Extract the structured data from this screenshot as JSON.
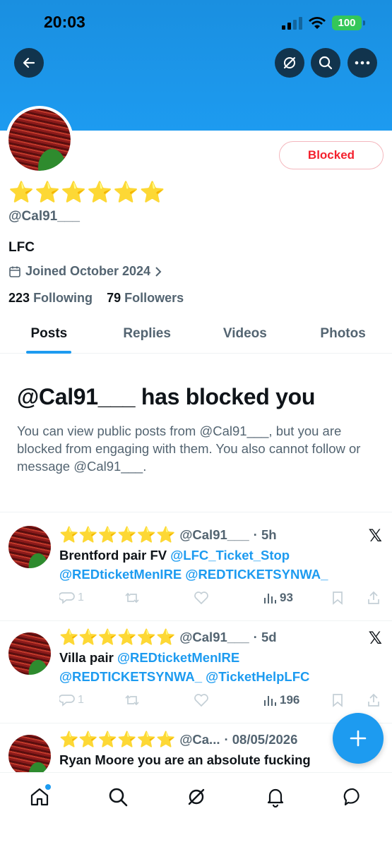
{
  "status_bar": {
    "time": "20:03",
    "battery": "100"
  },
  "header": {
    "back_icon": "arrow-left-icon",
    "grok_icon": "grok-icon",
    "search_icon": "search-icon",
    "more_icon": "more-horizontal-icon"
  },
  "profile": {
    "stars": "⭐⭐⭐⭐⭐⭐",
    "handle": "@Cal91___",
    "bio": "LFC",
    "joined": "Joined October 2024",
    "following_count": "223",
    "following_label": "Following",
    "followers_count": "79",
    "followers_label": "Followers",
    "blocked_label": "Blocked"
  },
  "tabs": [
    {
      "label": "Posts",
      "active": true
    },
    {
      "label": "Replies"
    },
    {
      "label": "Videos"
    },
    {
      "label": "Photos"
    }
  ],
  "blocked_notice": {
    "title": "@Cal91___ has blocked you",
    "description": "You can view public posts from @Cal91___, but you are blocked from engaging with them. You also cannot follow or message @Cal91___."
  },
  "posts": [
    {
      "stars": "⭐⭐⭐⭐⭐⭐",
      "handle": "@Cal91___",
      "time": "· 5h",
      "text_plain": "Brentford pair FV ",
      "mention1": "@LFC_Ticket_Stop",
      "mention2": "@REDticketMenIRE @REDTICKETSYNWA_",
      "replies": "1",
      "views": "93"
    },
    {
      "stars": "⭐⭐⭐⭐⭐⭐",
      "handle": "@Cal91___",
      "time": "· 5d",
      "text_plain": "Villa pair ",
      "mention1": "@REDticketMenIRE",
      "mention2": "@REDTICKETSYNWA_ @TicketHelpLFC",
      "replies": "1",
      "views": "196"
    },
    {
      "stars": "⭐⭐⭐⭐⭐⭐",
      "handle": "@Ca...",
      "time": "· 08/05/2026",
      "text_plain": "Ryan Moore you are an absolute fucking"
    }
  ],
  "fab_icon": "plus-icon",
  "bottom_nav": [
    "home-icon",
    "search-icon",
    "grok-icon",
    "bell-icon",
    "messages-icon"
  ],
  "colors": {
    "accent": "#1d9bf0",
    "blocked": "#f4212e",
    "muted": "#536471"
  }
}
